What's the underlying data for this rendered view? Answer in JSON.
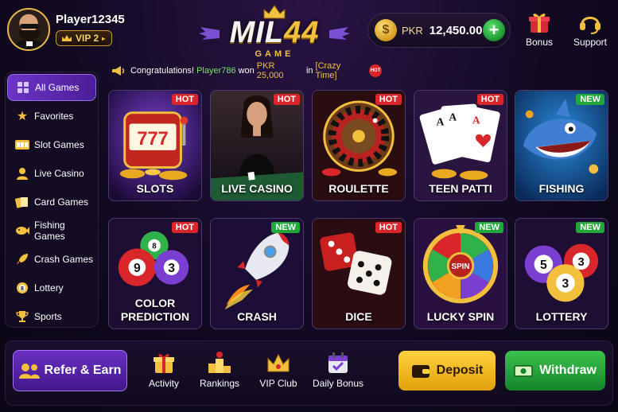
{
  "header": {
    "player_name": "Player12345",
    "vip_label": "VIP 2",
    "logo_main_a": "MIL",
    "logo_main_b": "44",
    "logo_sub": "GAME",
    "currency": "PKR",
    "balance": "12,450.00",
    "add_symbol": "+",
    "bonus_label": "Bonus",
    "support_label": "Support"
  },
  "ticker": {
    "prefix": "Congratulations!",
    "winner": "Player786",
    "middle": "won",
    "prize": "PKR 25,000",
    "in_word": "in",
    "game": "[Crazy Time]",
    "hot_badge": "HOT"
  },
  "sidebar": {
    "items": [
      {
        "label": "All Games",
        "icon": "grid-icon"
      },
      {
        "label": "Favorites",
        "icon": "star-icon"
      },
      {
        "label": "Slot Games",
        "icon": "slot-icon"
      },
      {
        "label": "Live Casino",
        "icon": "dealer-icon"
      },
      {
        "label": "Card Games",
        "icon": "cards-icon"
      },
      {
        "label": "Fishing Games",
        "icon": "fish-icon"
      },
      {
        "label": "Crash Games",
        "icon": "rocket-icon"
      },
      {
        "label": "Lottery",
        "icon": "lottery-ball-icon"
      },
      {
        "label": "Sports",
        "icon": "trophy-icon"
      }
    ]
  },
  "games": [
    {
      "label": "SLOTS",
      "tag": "HOT"
    },
    {
      "label": "LIVE CASINO",
      "tag": "HOT"
    },
    {
      "label": "ROULETTE",
      "tag": "HOT"
    },
    {
      "label": "TEEN PATTI",
      "tag": "HOT"
    },
    {
      "label": "FISHING",
      "tag": "NEW"
    },
    {
      "label": "COLOR",
      "label2": "PREDICTION",
      "tag": "HOT"
    },
    {
      "label": "CRASH",
      "tag": "NEW"
    },
    {
      "label": "DICE",
      "tag": "HOT"
    },
    {
      "label": "LUCKY SPIN",
      "tag": "NEW"
    },
    {
      "label": "LOTTERY",
      "tag": "NEW"
    }
  ],
  "art_text": {
    "slots_reels": "777",
    "roulette_ball": "",
    "color_balls": [
      "8",
      "9",
      "3"
    ],
    "spin_center": "SPIN",
    "lottery_balls": [
      "5",
      "3",
      "3"
    ]
  },
  "bottom": {
    "refer_label": "Refer & Earn",
    "activity_label": "Activity",
    "rankings_label": "Rankings",
    "vip_club_label": "VIP Club",
    "daily_bonus_label": "Daily Bonus",
    "deposit_label": "Deposit",
    "withdraw_label": "Withdraw"
  },
  "colors": {
    "background": "#120a22",
    "accent_purple": "#6d34c8",
    "gold": "#f2c03c",
    "hot_red": "#d8262a",
    "new_green": "#22a83a",
    "deposit_yellow": "#ffd23e",
    "withdraw_green": "#3cc24e"
  }
}
